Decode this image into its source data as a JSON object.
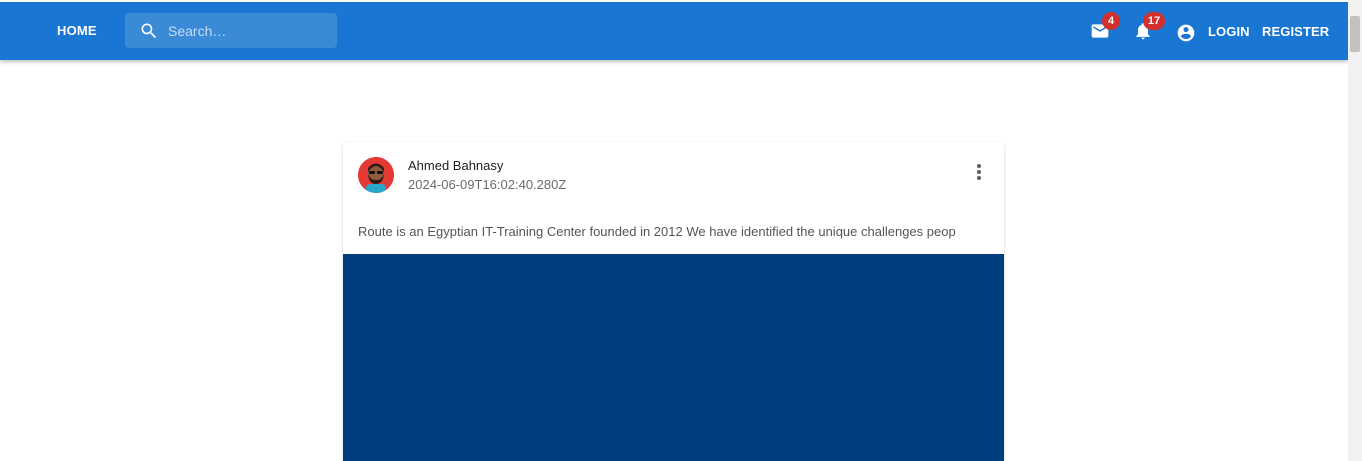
{
  "appbar": {
    "home_label": "HOME",
    "search_placeholder": "Search…",
    "mail_badge": "4",
    "notifications_badge": "17",
    "login_label": "LOGIN",
    "register_label": "REGISTER",
    "colors": {
      "primary": "#1976d2",
      "badge": "#d32f2f"
    },
    "icons": [
      "search-icon",
      "mail-icon",
      "bell-icon",
      "account-circle-icon"
    ]
  },
  "post": {
    "author": "Ahmed Bahnasy",
    "timestamp": "2024-06-09T16:02:40.280Z",
    "text": "Route is an Egyptian IT-Training Center founded in 2012 We have identified the unique challenges peop",
    "media_color": "#003f7f",
    "icons": [
      "avatar",
      "more-vert-icon"
    ]
  }
}
